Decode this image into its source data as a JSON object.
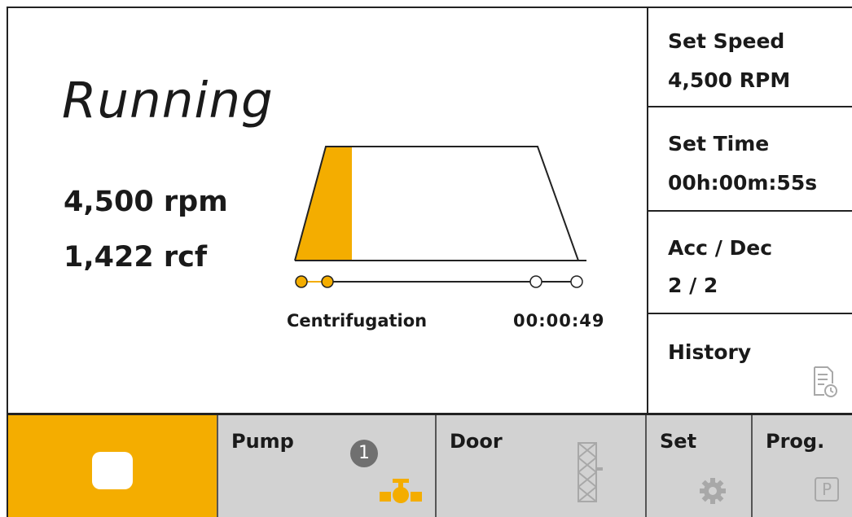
{
  "status": {
    "title": "Running",
    "speed": "4,500 rpm",
    "rcf": "1,422 rcf",
    "stage": "Centrifugation",
    "elapsed": "00:00:49",
    "progress_fraction": 0.16
  },
  "sidebar": {
    "set_speed": {
      "label": "Set Speed",
      "value": "4,500 RPM"
    },
    "set_time": {
      "label": "Set Time",
      "value": "00h:00m:55s"
    },
    "acc_dec": {
      "label": "Acc / Dec",
      "value": "2 / 2"
    },
    "history": {
      "label": "History"
    }
  },
  "bottom": {
    "pump_label": "Pump",
    "pump_badge": "1",
    "door_label": "Door",
    "set_label": "Set",
    "prog_label": "Prog.",
    "prog_icon_text": "P"
  },
  "colors": {
    "accent": "#f4ad00",
    "button_bg": "#d2d2d2",
    "icon_gray": "#a8a8a8"
  }
}
